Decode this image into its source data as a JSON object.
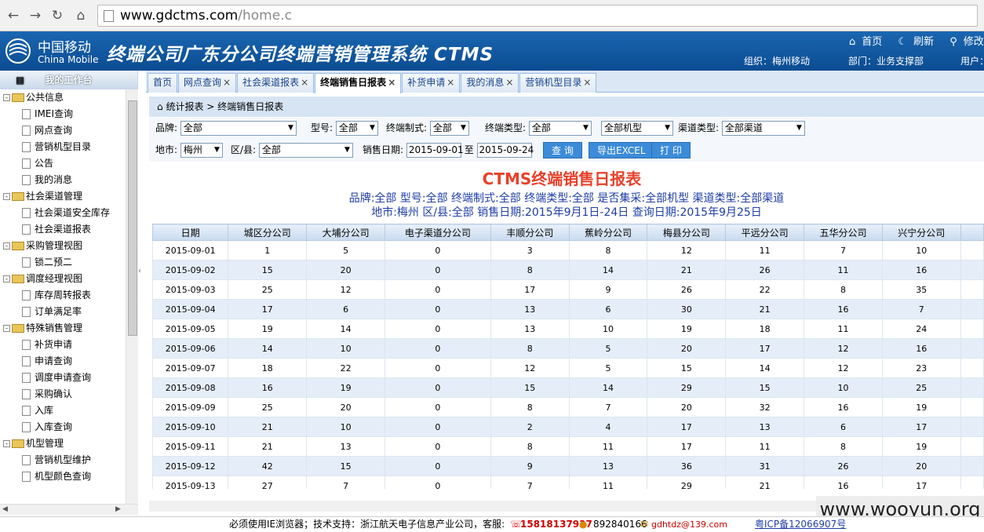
{
  "browser": {
    "url_host": "www.gdctms.com",
    "url_path": "/home.c"
  },
  "header": {
    "logo_cn": "中国移动",
    "logo_en": "China Mobile",
    "title": "终端公司广东分公司终端营销管理系统 CTMS",
    "links": [
      "首页",
      "刷新",
      "修改密码"
    ],
    "org": "组织：梅州移动",
    "dept": "部门：业务支撑部",
    "user": "用户："
  },
  "sidebar": {
    "title": "我的工作台",
    "tree": [
      {
        "type": "group",
        "label": "公共信息"
      },
      {
        "type": "item",
        "label": "IMEI查询"
      },
      {
        "type": "item",
        "label": "网点查询"
      },
      {
        "type": "item",
        "label": "营销机型目录"
      },
      {
        "type": "item",
        "label": "公告"
      },
      {
        "type": "item",
        "label": "我的消息"
      },
      {
        "type": "group",
        "label": "社会渠道管理"
      },
      {
        "type": "item",
        "label": "社会渠道安全库存"
      },
      {
        "type": "item",
        "label": "社会渠道报表"
      },
      {
        "type": "group",
        "label": "采购管理视图"
      },
      {
        "type": "item",
        "label": "锁二预二"
      },
      {
        "type": "group",
        "label": "调度经理视图"
      },
      {
        "type": "item",
        "label": "库存周转报表"
      },
      {
        "type": "item",
        "label": "订单满足率"
      },
      {
        "type": "group",
        "label": "特殊销售管理"
      },
      {
        "type": "item",
        "label": "补货申请"
      },
      {
        "type": "item",
        "label": "申请查询"
      },
      {
        "type": "item",
        "label": "调度申请查询"
      },
      {
        "type": "item",
        "label": "采购确认"
      },
      {
        "type": "item",
        "label": "入库"
      },
      {
        "type": "item",
        "label": "入库查询"
      },
      {
        "type": "group",
        "label": "机型管理"
      },
      {
        "type": "item",
        "label": "营销机型维护"
      },
      {
        "type": "item",
        "label": "机型颜色查询"
      }
    ]
  },
  "tabs": [
    {
      "label": "首页",
      "closable": false,
      "active": false
    },
    {
      "label": "网点查询",
      "closable": true,
      "active": false
    },
    {
      "label": "社会渠道报表",
      "closable": true,
      "active": false
    },
    {
      "label": "终端销售日报表",
      "closable": true,
      "active": true
    },
    {
      "label": "补货申请",
      "closable": true,
      "active": false
    },
    {
      "label": "我的消息",
      "closable": true,
      "active": false
    },
    {
      "label": "营销机型目录",
      "closable": true,
      "active": false
    }
  ],
  "breadcrumb": {
    "parent": "统计报表",
    "sep": ">",
    "current": "终端销售日报表"
  },
  "filters": {
    "brand_label": "品牌:",
    "brand_value": "全部",
    "model_label": "型号:",
    "model_value": "全部",
    "standard_label": "终端制式:",
    "standard_value": "全部",
    "type_label": "终端类型:",
    "type_value": "全部",
    "collect_value": "全部机型",
    "channel_label": "渠道类型:",
    "channel_value": "全部渠道",
    "city_label": "地市:",
    "city_value": "梅州",
    "county_label": "区/县:",
    "county_value": "全部",
    "date_label": "销售日期:",
    "date_from": "2015-09-01",
    "date_to_label": "至",
    "date_to": "2015-09-24",
    "query_button": "查 询",
    "export_button": "导出EXCEL",
    "print_button": "打 印"
  },
  "report": {
    "title": "CTMS终端销售日报表",
    "info_line1": "品牌:全部  型号:全部  终端制式:全部  终端类型:全部  是否集采:全部机型  渠道类型:全部渠道",
    "info_line2": "地市:梅州  区/县:全部  销售日期:2015年9月1日-24日  查询日期:2015年9月25日"
  },
  "table": {
    "columns": [
      "日期",
      "城区分公司",
      "大埔分公司",
      "电子渠道分公司",
      "丰顺分公司",
      "蕉岭分公司",
      "梅县分公司",
      "平远分公司",
      "五华分公司",
      "兴宁分公司"
    ],
    "rows": [
      [
        "2015-09-01",
        "1",
        "5",
        "0",
        "3",
        "8",
        "12",
        "11",
        "7",
        "10"
      ],
      [
        "2015-09-02",
        "15",
        "20",
        "0",
        "8",
        "14",
        "21",
        "26",
        "11",
        "16"
      ],
      [
        "2015-09-03",
        "25",
        "12",
        "0",
        "17",
        "9",
        "26",
        "22",
        "8",
        "35"
      ],
      [
        "2015-09-04",
        "17",
        "6",
        "0",
        "13",
        "6",
        "30",
        "21",
        "16",
        "7"
      ],
      [
        "2015-09-05",
        "19",
        "14",
        "0",
        "13",
        "10",
        "19",
        "18",
        "11",
        "24"
      ],
      [
        "2015-09-06",
        "14",
        "10",
        "0",
        "8",
        "5",
        "20",
        "17",
        "12",
        "16"
      ],
      [
        "2015-09-07",
        "18",
        "22",
        "0",
        "12",
        "5",
        "15",
        "14",
        "12",
        "23"
      ],
      [
        "2015-09-08",
        "16",
        "19",
        "0",
        "15",
        "14",
        "29",
        "15",
        "10",
        "25"
      ],
      [
        "2015-09-09",
        "25",
        "20",
        "0",
        "8",
        "7",
        "20",
        "32",
        "16",
        "19"
      ],
      [
        "2015-09-10",
        "21",
        "10",
        "0",
        "2",
        "4",
        "17",
        "13",
        "6",
        "17"
      ],
      [
        "2015-09-11",
        "21",
        "13",
        "0",
        "8",
        "11",
        "17",
        "11",
        "8",
        "19"
      ],
      [
        "2015-09-12",
        "42",
        "15",
        "0",
        "9",
        "13",
        "36",
        "31",
        "26",
        "20"
      ],
      [
        "2015-09-13",
        "27",
        "7",
        "0",
        "7",
        "11",
        "29",
        "21",
        "16",
        "17"
      ]
    ]
  },
  "footer": {
    "browser_note": "必须使用IE浏览器；技术支持：浙江航天电子信息产业公司，客服:",
    "phone": "15818137937",
    "qq": "892840166",
    "email": "gdhtdz@139.com",
    "icp": "粤ICP备12066907号"
  },
  "watermark": "www.wooyun.org"
}
